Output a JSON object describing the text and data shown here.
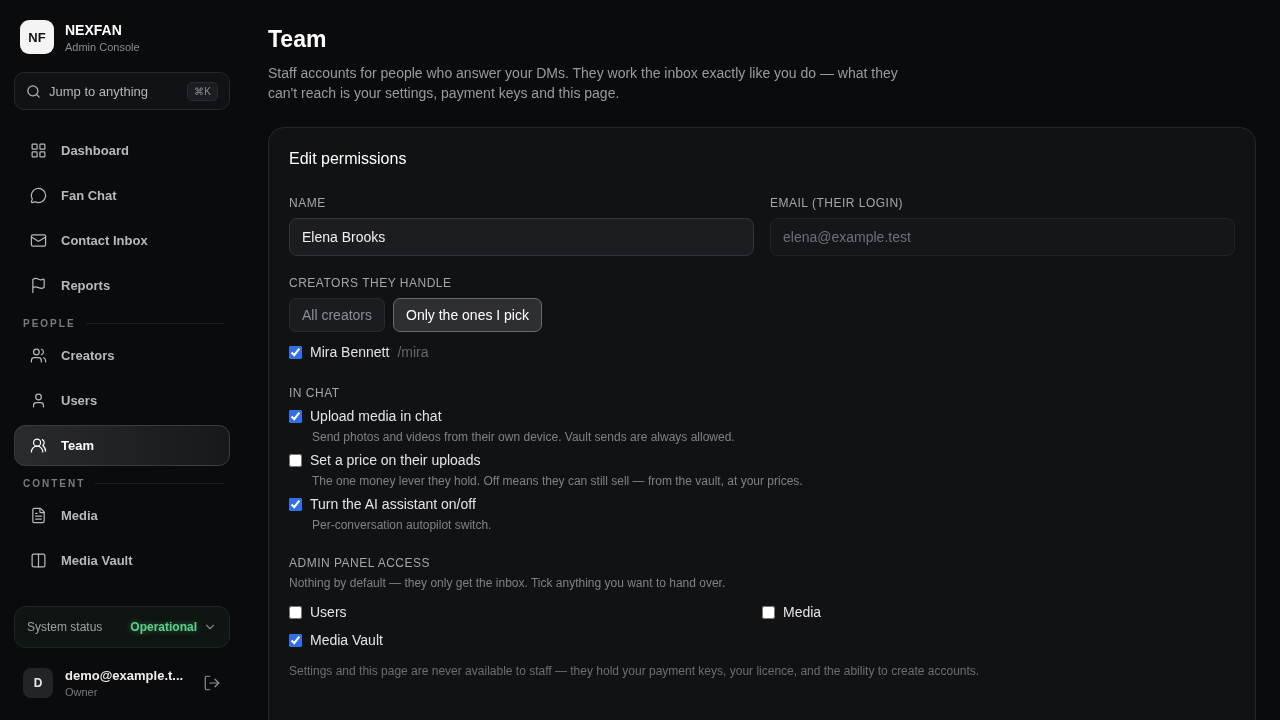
{
  "brand": {
    "logo": "NF",
    "name": "NEXFAN",
    "subtitle": "Admin Console"
  },
  "search": {
    "placeholder": "Jump to anything",
    "shortcut": "⌘K"
  },
  "nav_sections": [
    {
      "items": [
        {
          "label": "Dashboard",
          "selected": false
        },
        {
          "label": "Fan Chat",
          "selected": false
        },
        {
          "label": "Contact Inbox",
          "selected": false
        },
        {
          "label": "Reports",
          "selected": false
        }
      ]
    },
    {
      "title": "PEOPLE",
      "items": [
        {
          "label": "Creators",
          "selected": false
        },
        {
          "label": "Users",
          "selected": false
        },
        {
          "label": "Team",
          "selected": true
        }
      ]
    },
    {
      "title": "CONTENT",
      "items": [
        {
          "label": "Media",
          "selected": false
        },
        {
          "label": "Media Vault",
          "selected": false
        }
      ]
    }
  ],
  "system_status": {
    "label": "System status",
    "value": "Operational",
    "color": "#5fd08a"
  },
  "account": {
    "avatar": "D",
    "email": "demo@example.t...",
    "role": "Owner"
  },
  "page": {
    "title": "Team",
    "description": "Staff accounts for people who answer your DMs. They work the inbox exactly like you do — what they can't reach is your settings, payment keys and this page."
  },
  "card": {
    "title": "Edit permissions",
    "fields": [
      {
        "label": "NAME",
        "value": "Elena Brooks",
        "disabled": false
      },
      {
        "label": "EMAIL (THEIR LOGIN)",
        "value": "elena@example.test",
        "disabled": true
      }
    ],
    "creators": {
      "label": "CREATORS THEY HANDLE",
      "options": [
        {
          "label": "All creators",
          "selected": false
        },
        {
          "label": "Only the ones I pick",
          "selected": true
        }
      ],
      "list": [
        {
          "name": "Mira Bennett",
          "handle": "/mira",
          "checked": true
        }
      ]
    },
    "in_chat": {
      "label": "IN CHAT",
      "items": [
        {
          "label": "Upload media in chat",
          "hint": "Send photos and videos from their own device. Vault sends are always allowed.",
          "checked": true
        },
        {
          "label": "Set a price on their uploads",
          "hint": "The one money lever they hold. Off means they can still sell — from the vault, at your prices.",
          "checked": false
        },
        {
          "label": "Turn the AI assistant on/off",
          "hint": "Per-conversation autopilot switch.",
          "checked": true
        }
      ]
    },
    "admin_access": {
      "label": "ADMIN PANEL ACCESS",
      "description": "Nothing by default — they only get the inbox. Tick anything you want to hand over.",
      "items": [
        {
          "label": "Users",
          "checked": false
        },
        {
          "label": "Media",
          "checked": false
        },
        {
          "label": "Media Vault",
          "checked": true
        }
      ],
      "note": "Settings and this page are never available to staff — they hold your payment keys, your licence, and the ability to create accounts."
    }
  }
}
